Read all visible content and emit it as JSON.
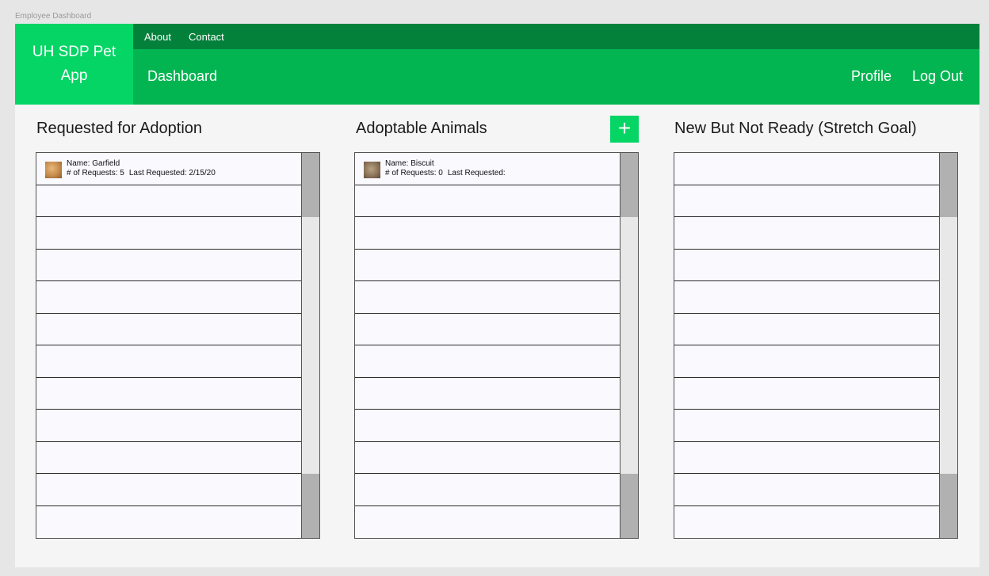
{
  "window": {
    "title": "Employee Dashboard"
  },
  "header": {
    "logo_text": "UH SDP Pet App",
    "top_links": [
      "About",
      "Contact"
    ],
    "nav": {
      "dashboard": "Dashboard",
      "profile": "Profile",
      "logout": "Log Out"
    }
  },
  "columns": [
    {
      "title": "Requested for Adoption",
      "items": [
        {
          "name": "Name: Garfield",
          "requests": "# of Requests: 5",
          "last_requested": "Last Requested: 2/15/20",
          "thumb": "cat-photo"
        }
      ]
    },
    {
      "title": "Adoptable Animals",
      "add_label": "+",
      "items": [
        {
          "name": "Name: Biscuit",
          "requests": "# of Requests: 0",
          "last_requested": "Last Requested:",
          "thumb": "dog-photo"
        }
      ]
    },
    {
      "title": "New But Not Ready (Stretch Goal)",
      "items": []
    }
  ],
  "colors": {
    "logo_green": "#05d565",
    "top_bar_green": "#03813b",
    "main_bar_green": "#02b551",
    "scrollbar_thumb": "#b1b1b1"
  }
}
